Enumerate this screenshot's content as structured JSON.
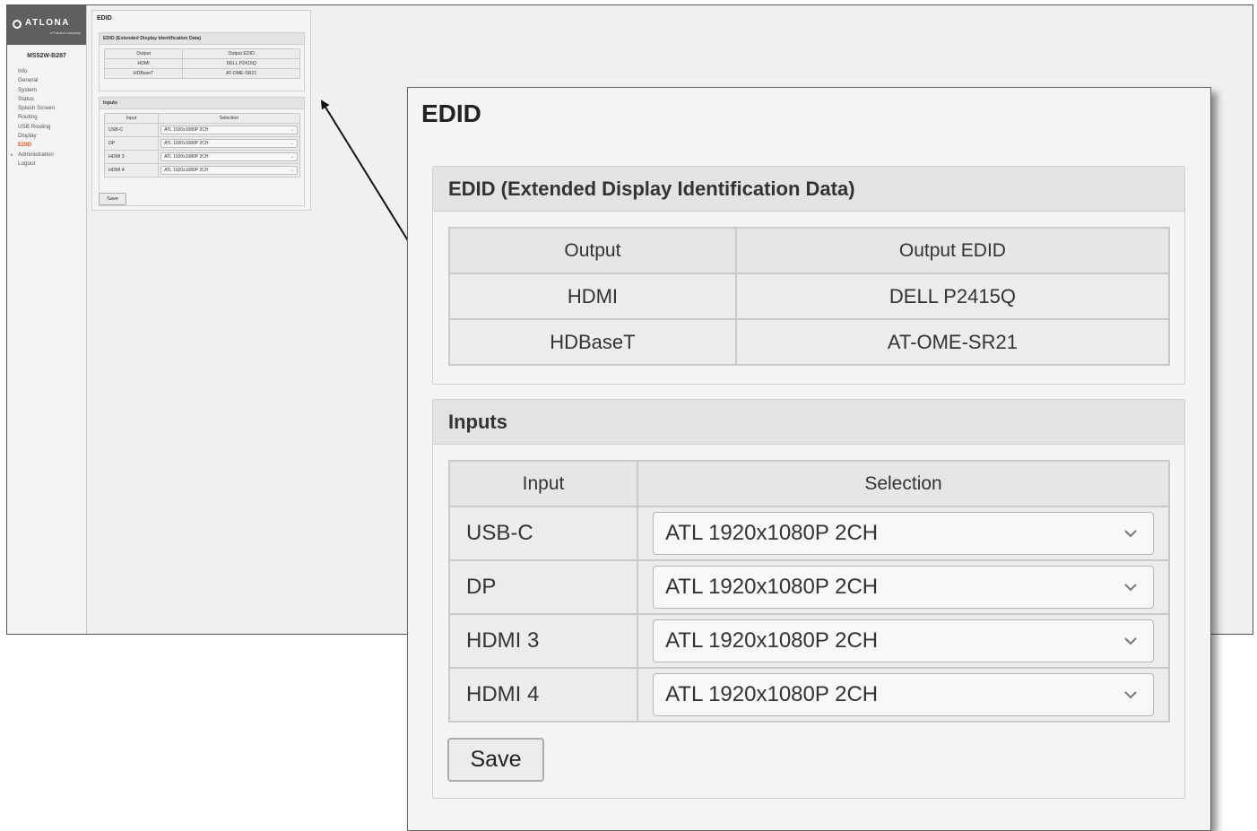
{
  "brand": {
    "name": "ATLONA",
    "tagline": "a Panduit company"
  },
  "device": {
    "model": "MS52W-B287"
  },
  "sidebar": {
    "items": [
      {
        "label": "Info"
      },
      {
        "label": "General"
      },
      {
        "label": "System"
      },
      {
        "label": "Status"
      },
      {
        "label": "Splash Screen"
      },
      {
        "label": "Routing"
      },
      {
        "label": "USB Routing"
      },
      {
        "label": "Display"
      },
      {
        "label": "EDID"
      },
      {
        "label": "Administration"
      },
      {
        "label": "Logout"
      }
    ],
    "active": "EDID"
  },
  "page": {
    "title": "EDID"
  },
  "edid_section": {
    "title": "EDID (Extended Display Identification Data)",
    "columns": [
      "Output",
      "Output EDID"
    ],
    "rows": [
      {
        "output": "HDMI",
        "edid": "DELL P2415Q"
      },
      {
        "output": "HDBaseT",
        "edid": "AT-OME-SR21"
      }
    ]
  },
  "inputs_section": {
    "title": "Inputs",
    "columns": [
      "Input",
      "Selection"
    ],
    "rows": [
      {
        "input": "USB-C",
        "selection": "ATL 1920x1080P 2CH"
      },
      {
        "input": "DP",
        "selection": "ATL 1920x1080P 2CH"
      },
      {
        "input": "HDMI 3",
        "selection": "ATL 1920x1080P 2CH"
      },
      {
        "input": "HDMI 4",
        "selection": "ATL 1920x1080P 2CH"
      }
    ]
  },
  "save_label": "Save",
  "colors": {
    "active_nav": "#e2561f",
    "logo_bar": "#5f5f5f",
    "panel_bg": "#f4f4f4",
    "header_bg": "#e3e3e3"
  }
}
